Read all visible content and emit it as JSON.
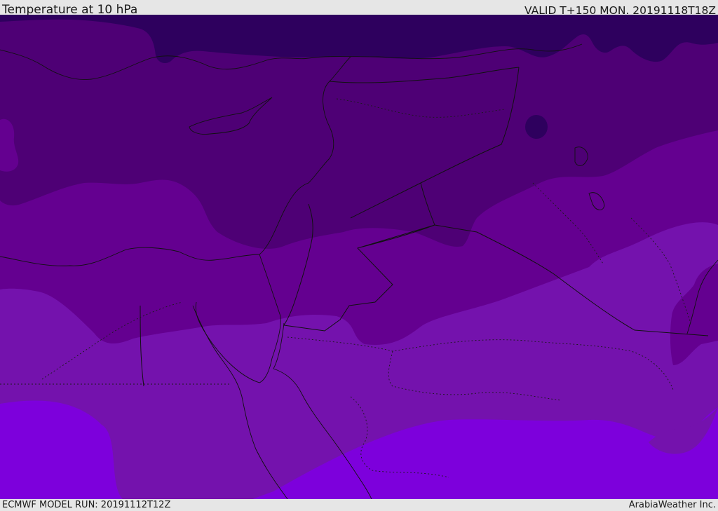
{
  "header": {
    "title": "Temperature at 10 hPa",
    "valid_time": "VALID T+150 MON. 20191118T18Z"
  },
  "footer": {
    "model_run": "ECMWF MODEL RUN: 20191112T12Z",
    "credit": "ArabiaWeather Inc."
  },
  "map": {
    "field": "temperature",
    "level": "10 hPa",
    "colors": {
      "band_coldest": "#2e005e",
      "band_1": "#4e0075",
      "band_2": "#640090",
      "band_3": "#7412ad",
      "band_warmest": "#7d00dc"
    }
  }
}
